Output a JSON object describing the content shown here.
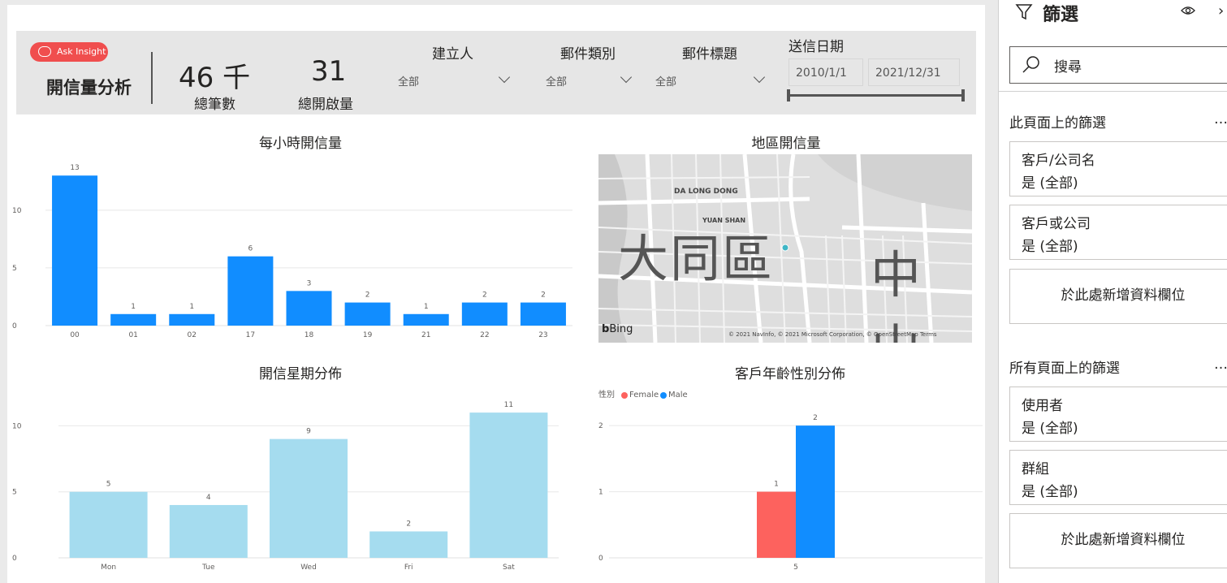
{
  "header": {
    "ask_insight": "Ask Insight",
    "title": "開信量分析",
    "kpi_total": {
      "value": "46 千",
      "label": "總筆數"
    },
    "kpi_open": {
      "value": "31",
      "label": "總開啟量"
    },
    "slicers": [
      {
        "title": "建立人",
        "value": "全部"
      },
      {
        "title": "郵件類別",
        "value": "全部"
      },
      {
        "title": "郵件標題",
        "value": "全部"
      }
    ],
    "date_slicer": {
      "title": "送信日期",
      "from": "2010/1/1",
      "to": "2021/12/31"
    }
  },
  "visuals": {
    "hourly_title": "每小時開信量",
    "map_title": "地區開信量",
    "weekday_title": "開信星期分佈",
    "agegender_title": "客戶年齡性別分佈"
  },
  "map": {
    "labels": {
      "district1": "大同區",
      "district2": "中山",
      "da_long_dong": "DA LONG DONG",
      "yuan_shan": "YUAN SHAN"
    },
    "bing": "Bing",
    "copyright": "© 2021 NavInfo, © 2021 Microsoft Corporation, © OpenStreetMap Terms"
  },
  "chart_data": [
    {
      "type": "bar",
      "title": "每小時開信量",
      "categories": [
        "00",
        "01",
        "02",
        "17",
        "18",
        "19",
        "21",
        "22",
        "23"
      ],
      "values": [
        13,
        1,
        1,
        6,
        3,
        2,
        1,
        2,
        2
      ],
      "ylim": [
        0,
        14
      ],
      "yticks": [
        0,
        5,
        10
      ],
      "color": "#118dff"
    },
    {
      "type": "bar",
      "title": "開信星期分佈",
      "categories": [
        "Mon",
        "Tue",
        "Wed",
        "Fri",
        "Sat"
      ],
      "values": [
        5,
        4,
        9,
        2,
        11
      ],
      "ylim": [
        0,
        11.5
      ],
      "yticks": [
        0,
        5,
        10
      ],
      "color": "#a5dcef"
    },
    {
      "type": "bar",
      "title": "客戶年齡性別分佈",
      "legend_title": "性別",
      "categories": [
        "5"
      ],
      "series": [
        {
          "name": "Female",
          "values": [
            1
          ],
          "color": "#fd625e"
        },
        {
          "name": "Male",
          "values": [
            2
          ],
          "color": "#118dff"
        }
      ],
      "ylim": [
        0,
        2.1
      ],
      "yticks": [
        0,
        1,
        2
      ]
    }
  ],
  "filter_panel": {
    "title": "篩選",
    "search_placeholder": "搜尋",
    "page_section": "此頁面上的篩選",
    "page_filters": [
      {
        "name": "客戶/公司名",
        "state": "是 (全部)"
      },
      {
        "name": "客戶或公司",
        "state": "是 (全部)"
      }
    ],
    "add_field": "於此處新增資料欄位",
    "all_section": "所有頁面上的篩選",
    "all_filters": [
      {
        "name": "使用者",
        "state": "是 (全部)"
      },
      {
        "name": "群組",
        "state": "是 (全部)"
      }
    ],
    "more": "…"
  }
}
